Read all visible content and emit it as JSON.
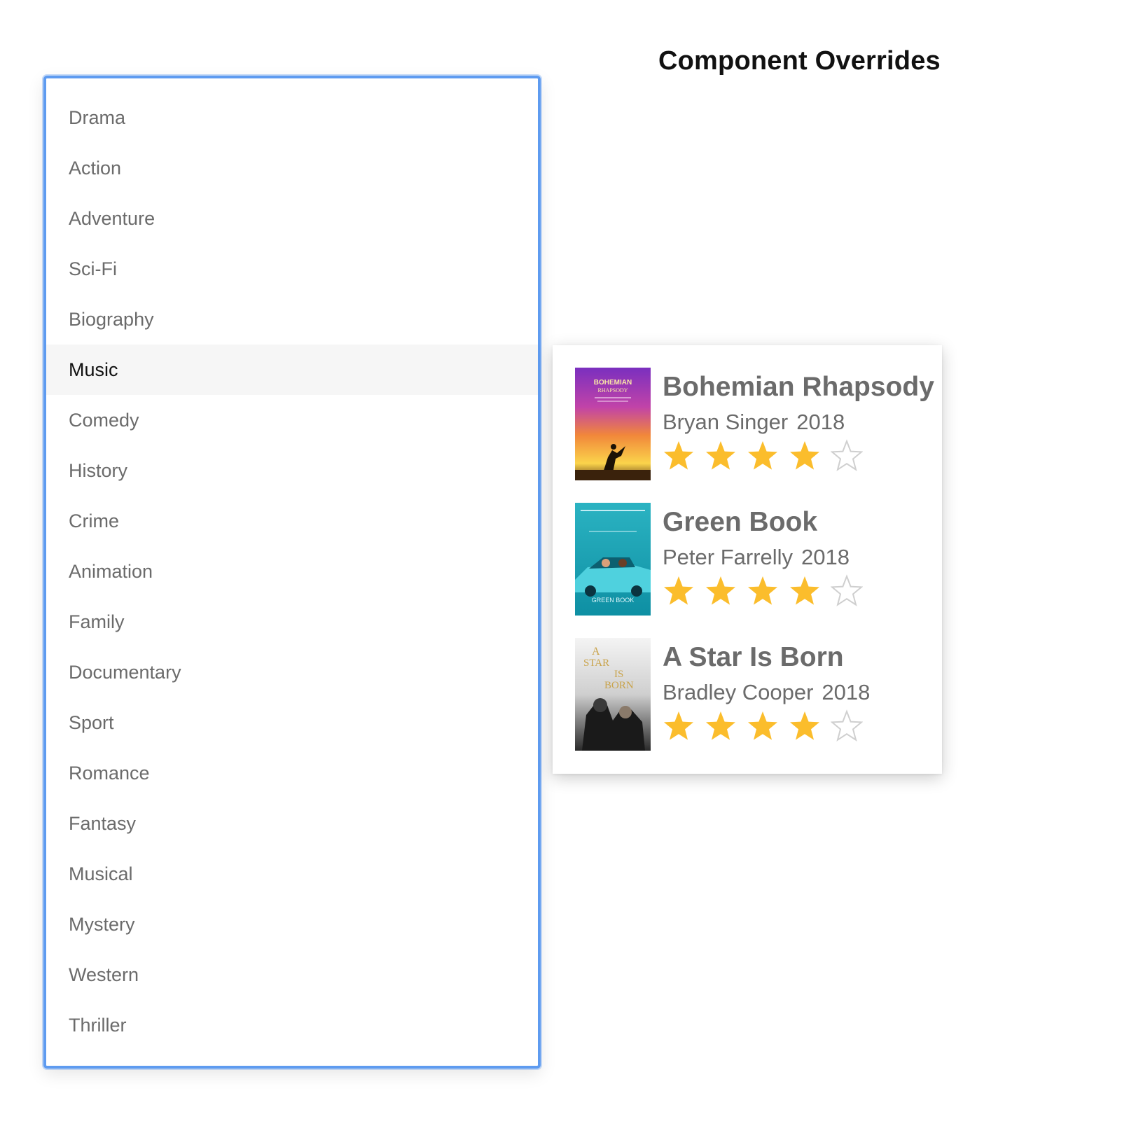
{
  "page": {
    "title": "Component Overrides"
  },
  "genres": {
    "selected": "Music",
    "items": [
      "Drama",
      "Action",
      "Adventure",
      "Sci-Fi",
      "Biography",
      "Music",
      "Comedy",
      "History",
      "Crime",
      "Animation",
      "Family",
      "Documentary",
      "Sport",
      "Romance",
      "Fantasy",
      "Musical",
      "Mystery",
      "Western",
      "Thriller"
    ]
  },
  "movies": [
    {
      "title": "Bohemian Rhapsody",
      "director": "Bryan Singer",
      "year": "2018",
      "rating": 4,
      "max_rating": 5,
      "poster_text": [
        "BOHEMIAN",
        "RHAPSODY"
      ]
    },
    {
      "title": "Green Book",
      "director": "Peter Farrelly",
      "year": "2018",
      "rating": 4,
      "max_rating": 5,
      "poster_text": [
        "GREEN BOOK"
      ]
    },
    {
      "title": "A Star Is Born",
      "director": "Bradley Cooper",
      "year": "2018",
      "rating": 4,
      "max_rating": 5,
      "poster_text": [
        "A",
        "STAR",
        "IS",
        "BORN"
      ]
    }
  ],
  "colors": {
    "focus_border": "#5e9bf0",
    "star_filled": "#fbbd2c",
    "star_empty": "#cfcfcf",
    "text_muted": "#6b6b6b",
    "selected_bg": "#f6f6f6"
  },
  "icons": {
    "star_filled": "star-filled-icon",
    "star_empty": "star-empty-icon"
  }
}
